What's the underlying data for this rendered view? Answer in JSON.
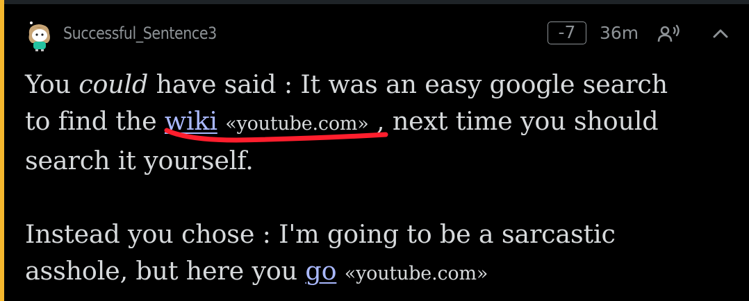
{
  "comment": {
    "author": "Successful_Sentence3",
    "score": "-7",
    "age": "36m",
    "colors": {
      "thread_line": "#f5b82e",
      "text": "#d7dadc",
      "meta": "#8e9397",
      "link": "#aab9ff",
      "annotation": "#ff1e2d"
    },
    "icons": {
      "avatar": "snoo-avatar-icon",
      "voice": "speaker-voice-icon",
      "collapse": "chevron-up-icon"
    },
    "paragraph1": {
      "t1": "You ",
      "italic": "could",
      "t2": " have said : It was an easy google search",
      "t3": "to find the ",
      "link": "wiki",
      "domain": "«youtube.com»",
      "t4": " , next time you should",
      "t5": "search it yourself."
    },
    "paragraph2": {
      "t1": "Instead you chose : I'm going to be a sarcastic",
      "t2": "asshole, but here you ",
      "link": "go",
      "domain": "«youtube.com»"
    }
  }
}
